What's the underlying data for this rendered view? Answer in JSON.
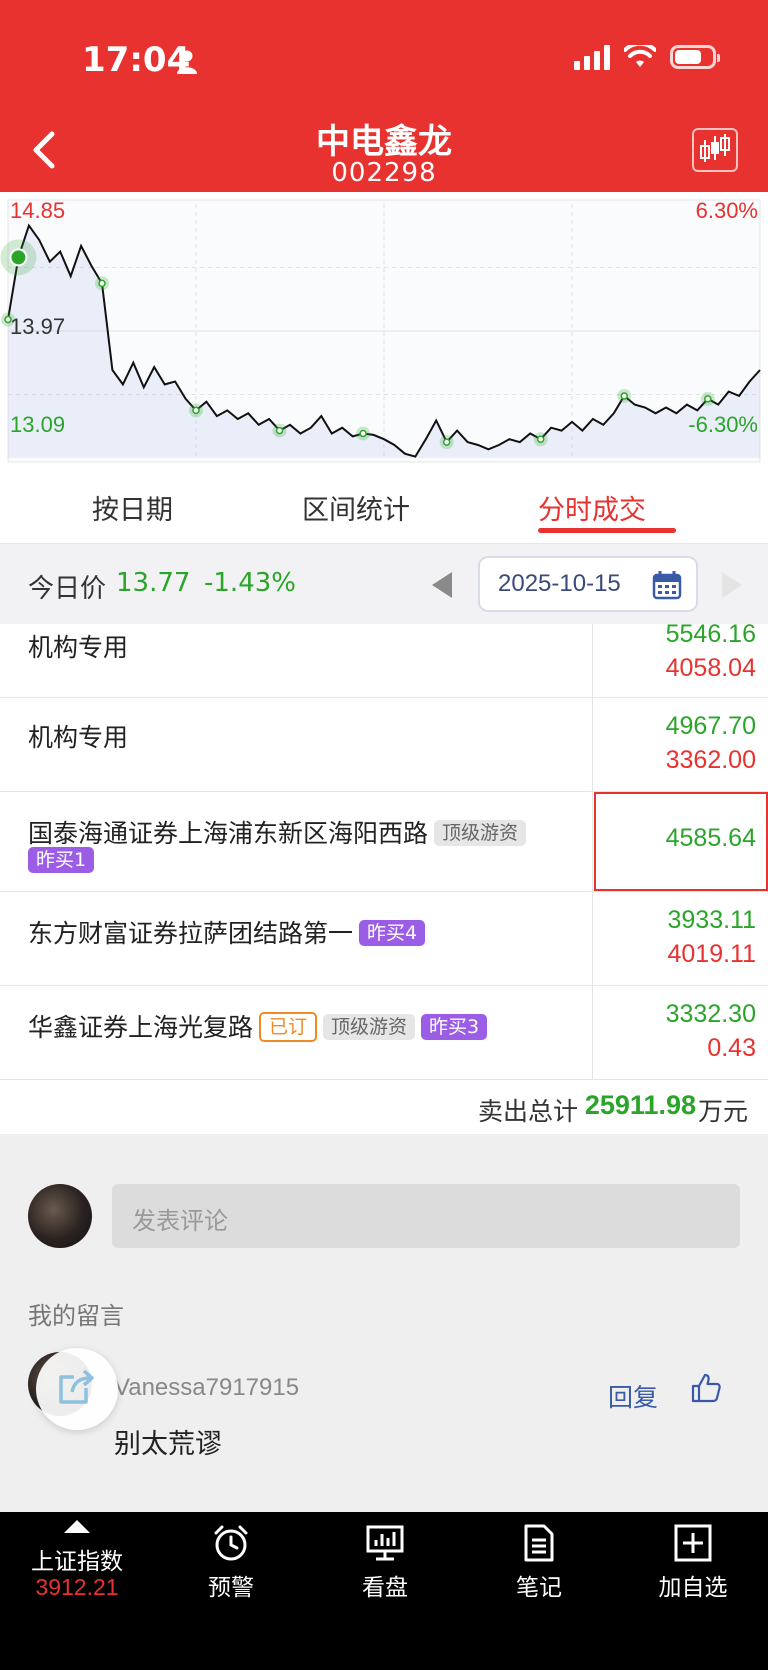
{
  "status": {
    "time": "17:04"
  },
  "header": {
    "title": "中电鑫龙",
    "code": "002298"
  },
  "chart_data": {
    "type": "line",
    "title": "",
    "price_labels": {
      "high": "14.85",
      "mid": "13.97",
      "low": "13.09"
    },
    "pct_labels": {
      "high": "6.30%",
      "low": "-6.30%"
    },
    "ylim": [
      13.09,
      14.85
    ],
    "series": [
      {
        "values": [
          14.05,
          14.48,
          14.7,
          14.6,
          14.45,
          14.52,
          14.35,
          14.56,
          14.42,
          14.3,
          13.7,
          13.6,
          13.75,
          13.58,
          13.72,
          13.6,
          13.62,
          13.5,
          13.42,
          13.48,
          13.38,
          13.42,
          13.36,
          13.4,
          13.32,
          13.36,
          13.28,
          13.32,
          13.26,
          13.3,
          13.38,
          13.26,
          13.3,
          13.24,
          13.26,
          13.25,
          13.22,
          13.18,
          13.12,
          13.1,
          13.22,
          13.35,
          13.2,
          13.28,
          13.2,
          13.18,
          13.15,
          13.18,
          13.22,
          13.2,
          13.26,
          13.22,
          13.3,
          13.28,
          13.34,
          13.28,
          13.36,
          13.32,
          13.4,
          13.52,
          13.46,
          13.44,
          13.4,
          13.44,
          13.4,
          13.46,
          13.42,
          13.5,
          13.46,
          13.55,
          13.52,
          13.62,
          13.7
        ]
      }
    ],
    "markers": 9
  },
  "tabs": [
    {
      "label": "按日期",
      "active": false
    },
    {
      "label": "区间统计",
      "active": false
    },
    {
      "label": "分时成交",
      "active": true
    }
  ],
  "pricebar": {
    "label": "今日价",
    "price": "13.77",
    "change_pct": "-1.43%",
    "date": "2025-10-15"
  },
  "rows": [
    {
      "broker": "机构专用",
      "buy": "5546.16",
      "sell": "4058.04"
    },
    {
      "broker": "机构专用",
      "buy": "4967.70",
      "sell": "3362.00"
    },
    {
      "broker": "国泰海通证券上海浦东新区海阳西路",
      "tag_gray": "顶级游资",
      "tag_purple": "昨买1",
      "buy": "4585.64"
    },
    {
      "broker": "东方财富证券拉萨团结路第一",
      "tag_purple": "昨买4",
      "buy": "3933.11",
      "sell": "4019.11"
    },
    {
      "broker": "华鑫证券上海光复路",
      "tag_orange": "已订",
      "tag_gray": "顶级游资",
      "tag_purple": "昨买3",
      "buy": "3332.30",
      "sell": "0.43"
    }
  ],
  "total": {
    "label": "卖出总计",
    "value": "25911.98",
    "unit": "万元"
  },
  "comments": {
    "placeholder": "发表评论",
    "my_messages_label": "我的留言",
    "item": {
      "username": "Vanessa7917915",
      "text": "别太荒谬",
      "reply_label": "回复"
    }
  },
  "bottombar": {
    "index_name": "上证指数",
    "index_value": "3912.21",
    "items": [
      {
        "label": "预警",
        "icon": "alarm-clock-icon"
      },
      {
        "label": "看盘",
        "icon": "monitor-chart-icon"
      },
      {
        "label": "笔记",
        "icon": "document-icon"
      },
      {
        "label": "加自选",
        "icon": "add-box-icon"
      }
    ]
  },
  "colors": {
    "brand_red": "#e8322f",
    "up_green": "#2aa52a",
    "tag_purple": "#9b5de5",
    "tag_orange": "#f08a24"
  }
}
